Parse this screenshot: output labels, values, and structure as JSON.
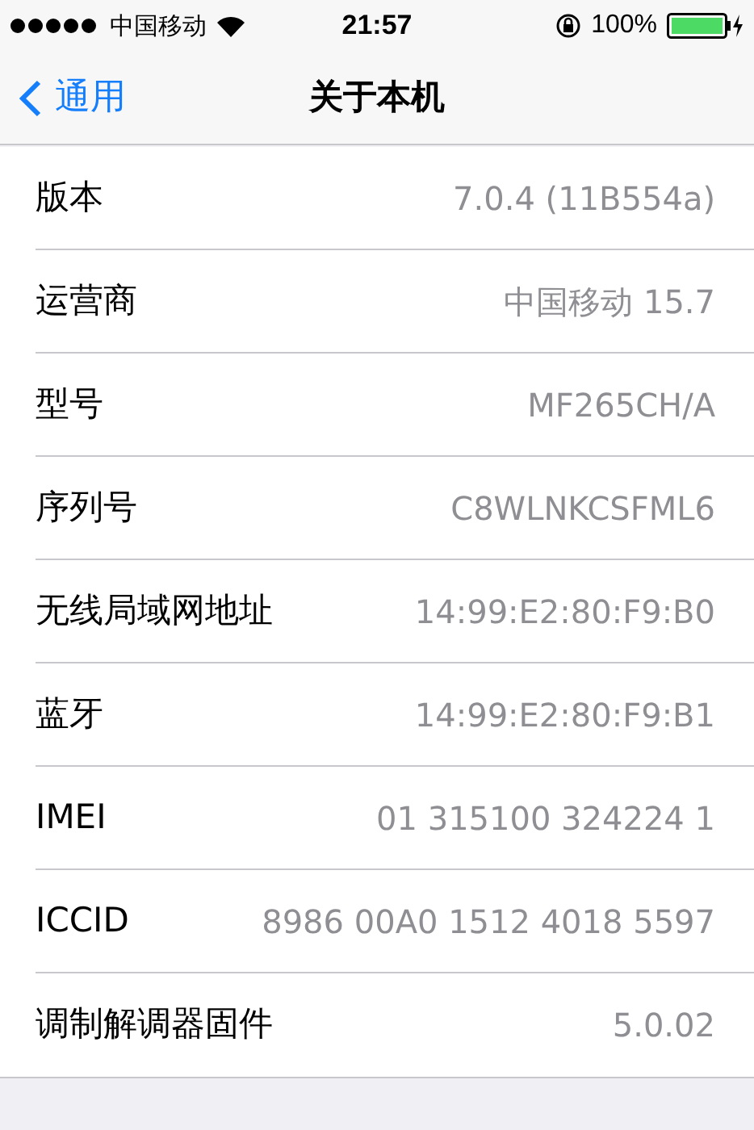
{
  "status_bar": {
    "carrier": "中国移动",
    "time": "21:57",
    "battery": "100%"
  },
  "nav": {
    "back": "通用",
    "title": "关于本机"
  },
  "rows": [
    {
      "label": "版本",
      "value": "7.0.4 (11B554a)"
    },
    {
      "label": "运营商",
      "value": "中国移动 15.7"
    },
    {
      "label": "型号",
      "value": "MF265CH/A"
    },
    {
      "label": "序列号",
      "value": "C8WLNKCSFML6"
    },
    {
      "label": "无线局域网地址",
      "value": "14:99:E2:80:F9:B0"
    },
    {
      "label": "蓝牙",
      "value": "14:99:E2:80:F9:B1"
    },
    {
      "label": "IMEI",
      "value": "01 315100 324224 1"
    },
    {
      "label": "ICCID",
      "value": "8986 00A0 1512 4018 5597"
    },
    {
      "label": "调制解调器固件",
      "value": "5.0.02"
    }
  ]
}
